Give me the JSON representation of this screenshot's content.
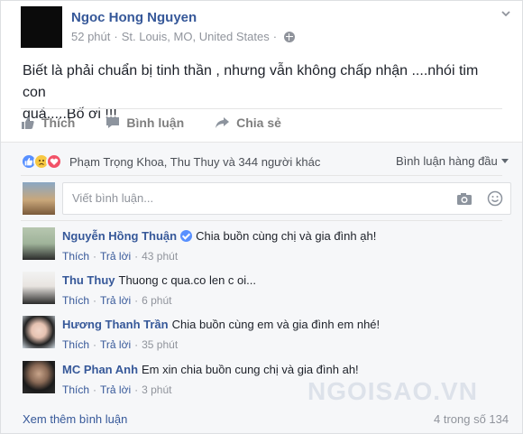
{
  "post": {
    "author": "Ngoc Hong Nguyen",
    "time": "52 phút",
    "location": "St. Louis, MO, United States",
    "separator": "·",
    "status_line1": "Biết là phải chuẩn bị tinh thần , nhưng vẫn không chấp nhận ....nhói tim con",
    "status_line2": "quá.....Bố ơi !!!"
  },
  "actions": {
    "like": "Thích",
    "comment": "Bình luận",
    "share": "Chia sẻ"
  },
  "reactions": {
    "names": "Phạm Trọng Khoa, Thu Thuy và 344 người khác",
    "sort_label": "Bình luận hàng đầu",
    "icons": [
      "like-icon",
      "sad-icon",
      "love-icon"
    ]
  },
  "comment_input": {
    "placeholder": "Viết bình luận..."
  },
  "comments": [
    {
      "name": "Nguyễn Hồng Thuận",
      "verified": true,
      "text": "Chia buồn cùng chị và gia đình ạh!",
      "like": "Thích",
      "reply": "Trả lời",
      "time": "43 phút"
    },
    {
      "name": "Thu Thuy",
      "verified": false,
      "text": "Thuong c qua.co len c oi...",
      "like": "Thích",
      "reply": "Trả lời",
      "time": "6 phút"
    },
    {
      "name": "Hương Thanh Trần",
      "verified": false,
      "text": "Chia buồn cùng em và gia đình em nhé!",
      "like": "Thích",
      "reply": "Trả lời",
      "time": "35 phút"
    },
    {
      "name": "MC Phan Anh",
      "verified": false,
      "text": "Em xin chia buồn cung chị và gia đình ah!",
      "like": "Thích",
      "reply": "Trả lời",
      "time": "3 phút"
    }
  ],
  "footer": {
    "more": "Xem thêm bình luận",
    "count": "4 trong số 134"
  },
  "watermark": "NGOISAO.VN",
  "colors": {
    "link": "#365899",
    "muted": "#90949c",
    "like": "#5890ff",
    "love": "#f25268",
    "sad": "#f7c843"
  }
}
